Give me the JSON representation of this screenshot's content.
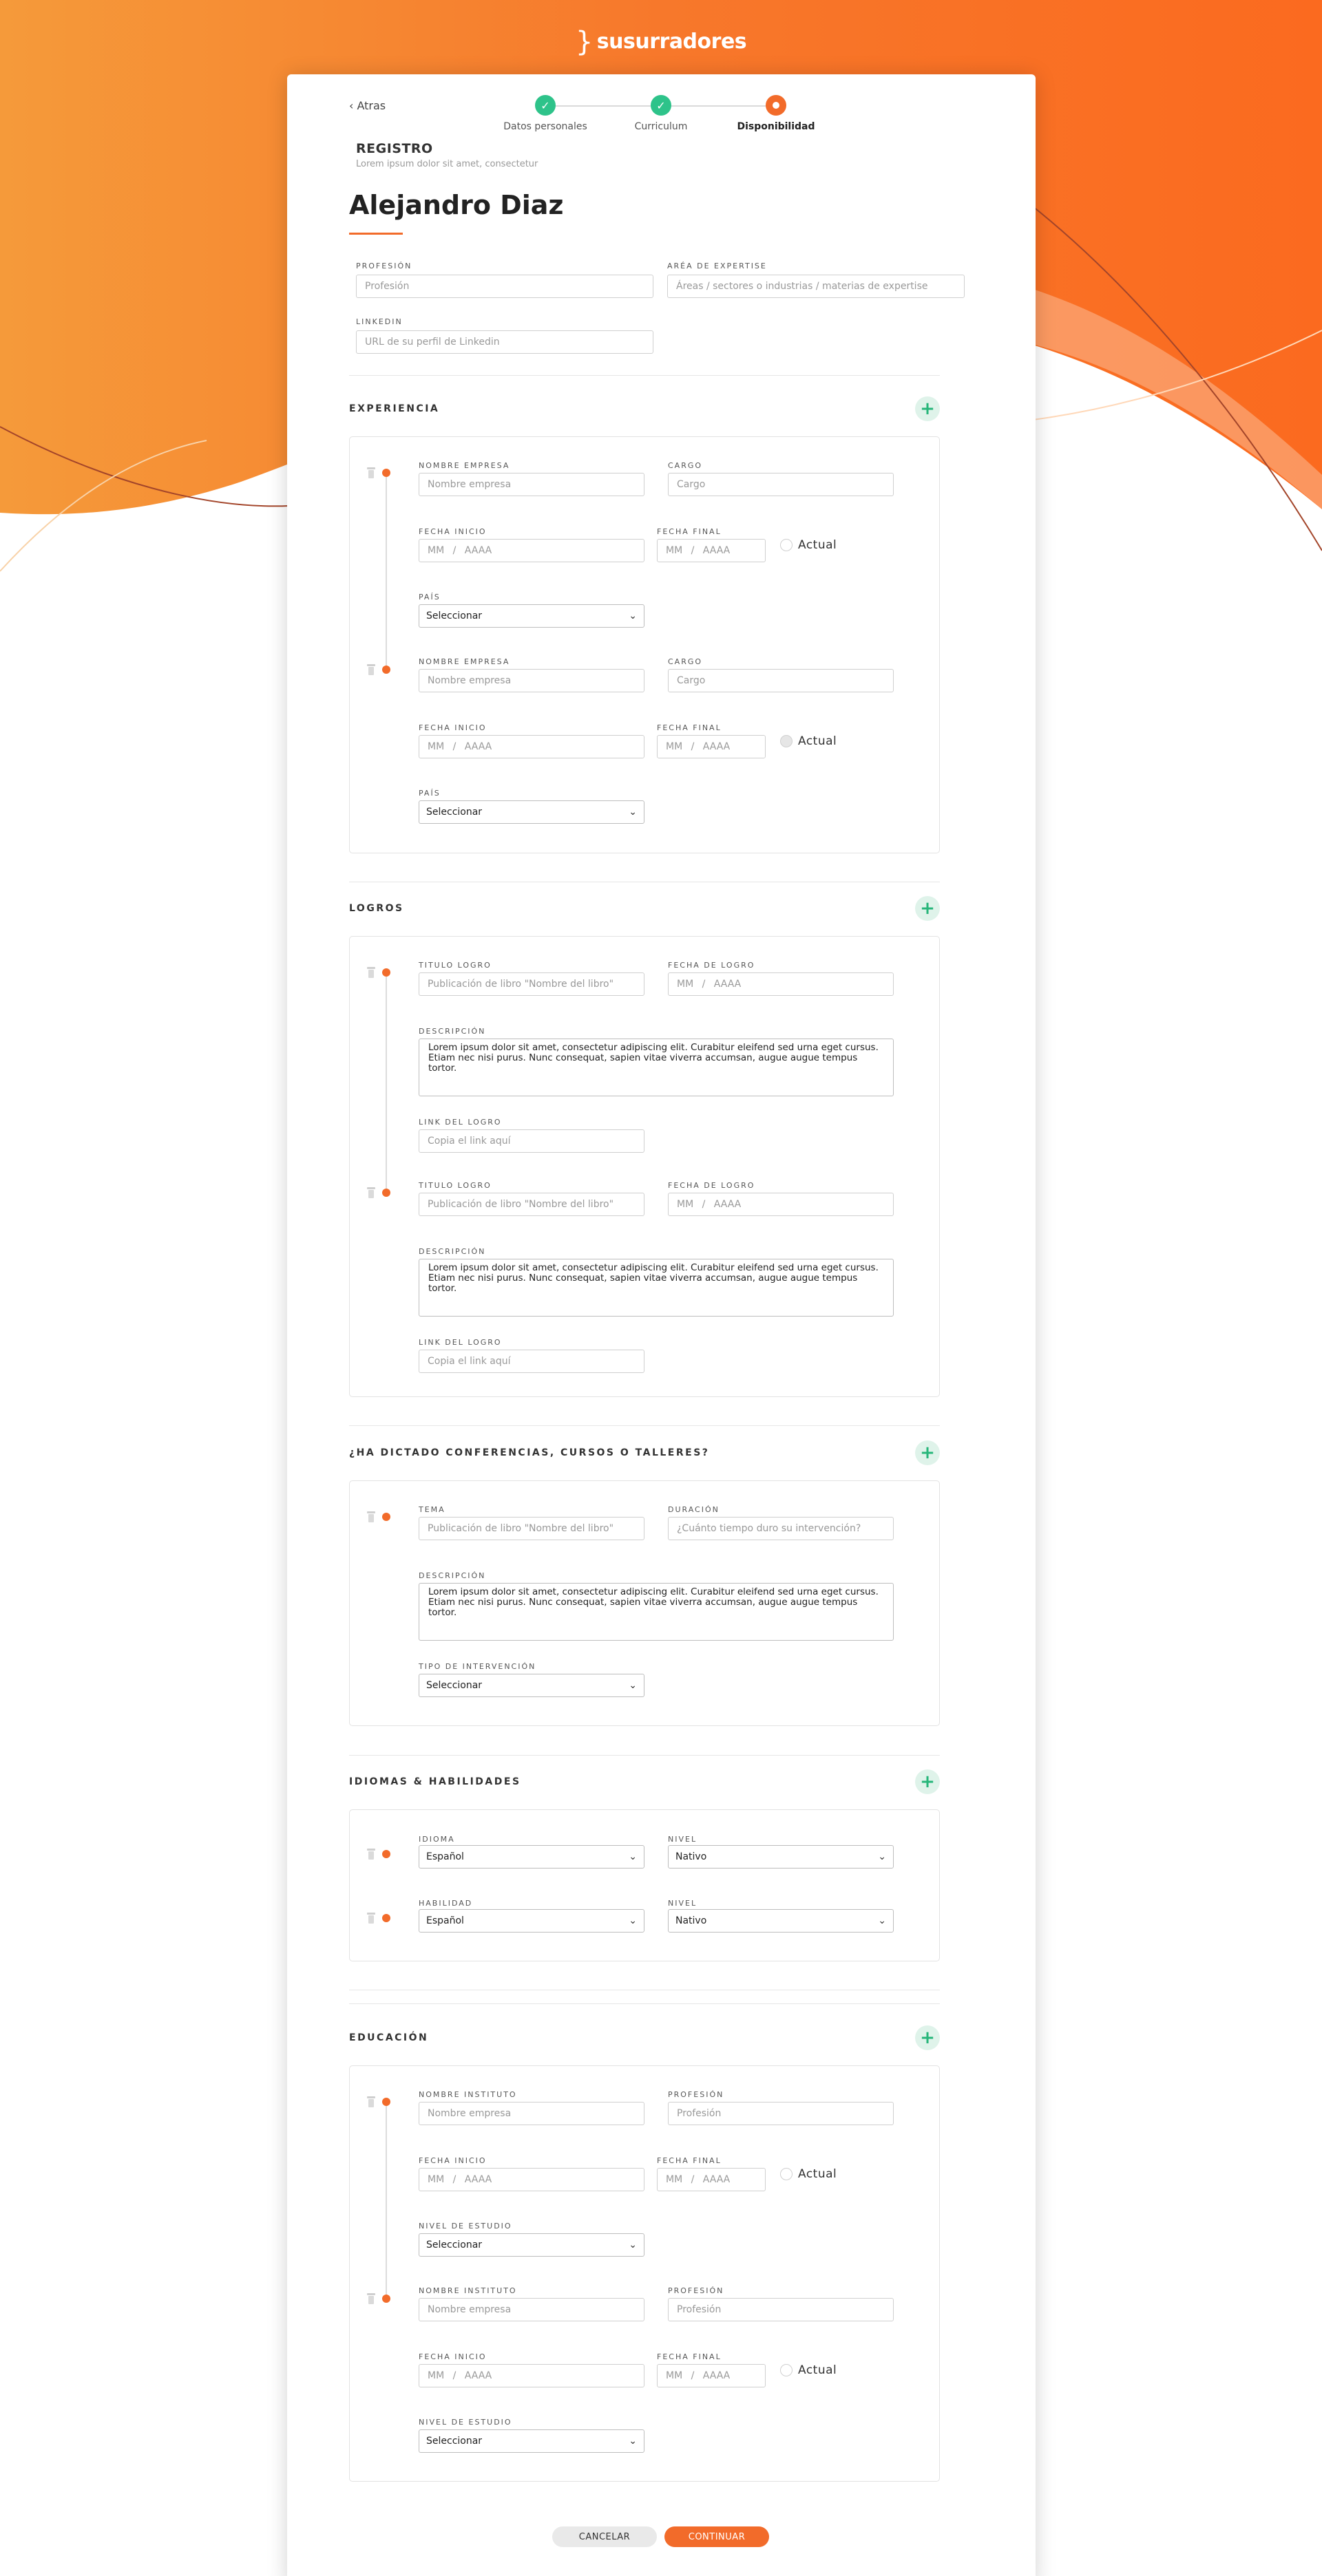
{
  "brand": {
    "name": "susurradores",
    "accent": "#f26b2a",
    "success": "#2ec38a"
  },
  "nav": {
    "back_label": "Atras"
  },
  "steps": [
    {
      "label": "Datos personales",
      "state": "done"
    },
    {
      "label": "Curriculum",
      "state": "done"
    },
    {
      "label": "Disponibilidad",
      "state": "active"
    }
  ],
  "header": {
    "title": "REGISTRO",
    "subtitle": "Lorem ipsum dolor sit amet, consectetur",
    "name": "Alejandro Diaz"
  },
  "profile": {
    "profesion_label": "PROFESIÓN",
    "profesion_placeholder": "Profesión",
    "area_label": "ARÉA DE EXPERTISE",
    "area_placeholder": "Áreas / sectores o industrias / materias de expertise",
    "linkedin_label": "LINKEDIN",
    "linkedin_placeholder": "URL de su perfil de Linkedin"
  },
  "common": {
    "date_placeholder": "MM  /  AAAA",
    "actual_label": "Actual",
    "select_default": "Seleccionar",
    "lorem": "Lorem ipsum dolor sit amet, consectetur adipiscing elit. Curabitur eleifend sed urna eget cursus. Etiam nec nisi purus. Nunc consequat, sapien vitae viverra accumsan, augue augue tempus tortor."
  },
  "experiencia": {
    "title": "EXPERIENCIA",
    "empresa_label": "NOMBRE EMPRESA",
    "empresa_placeholder": "Nombre empresa",
    "cargo_label": "CARGO",
    "cargo_placeholder": "Cargo",
    "inicio_label": "FECHA INICIO",
    "final_label": "FECHA FINAL",
    "pais_label": "PAÍS"
  },
  "logros": {
    "title": "LOGROS",
    "titulo_label": "TITULO LOGRO",
    "titulo_placeholder": "Publicación de libro \"Nombre del libro\"",
    "fecha_label": "FECHA DE LOGRO",
    "descripcion_label": "DESCRIPCIÓN",
    "link_label": "LINK DEL LOGRO",
    "link_placeholder": "Copia el link aquí"
  },
  "conferencias": {
    "title": "¿HA DICTADO CONFERENCIAS, CURSOS O TALLERES?",
    "tema_label": "TEMA",
    "tema_placeholder": "Publicación de libro \"Nombre del libro\"",
    "duracion_label": "DURACIÓN",
    "duracion_placeholder": "¿Cuánto tiempo duro su intervención?",
    "descripcion_label": "DESCRIPCIÓN",
    "tipo_label": "TIPO DE INTERVENCIÓN"
  },
  "idiomas": {
    "title": "IDIOMAS & HABILIDADES",
    "idioma_label": "IDIOMA",
    "habilidad_label": "HABILIDAD",
    "nivel_label": "NIVEL",
    "idioma_value": "Español",
    "habilidad_value": "Español",
    "nivel_value": "Nativo"
  },
  "educacion": {
    "title": "EDUCACIÓN",
    "instituto_label": "NOMBRE INSTITUTO",
    "instituto_placeholder": "Nombre empresa",
    "profesion_label": "PROFESIÓN",
    "profesion_placeholder": "Profesión",
    "inicio_label": "FECHA INICIO",
    "final_label": "FECHA FINAL",
    "nivel_label": "NIVEL DE ESTUDIO"
  },
  "footer": {
    "cancel_label": "CANCELAR",
    "continue_label": "CONTINUAR"
  }
}
